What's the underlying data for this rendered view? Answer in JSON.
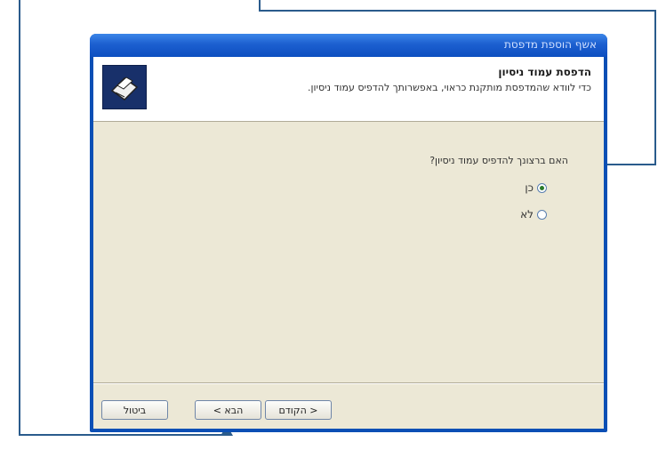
{
  "window": {
    "title": "אשף הוספת מדפסת"
  },
  "header": {
    "title": "הדפסת עמוד ניסיון",
    "subtitle": "כדי לוודא שהמדפסת מותקנת כראוי, באפשרותך להדפיס עמוד ניסיון."
  },
  "main": {
    "question": "האם ברצונך להדפיס עמוד ניסיון?",
    "options": [
      {
        "label": "כן",
        "selected": true
      },
      {
        "label": "לא",
        "selected": false
      }
    ]
  },
  "buttons": {
    "back": "< הקודם",
    "next": "הבא >",
    "cancel": "ביטול"
  },
  "colors": {
    "callout": "#2a5b8c",
    "titlebar": "#1c5fd0",
    "dialog_bg": "#ece8d6"
  }
}
